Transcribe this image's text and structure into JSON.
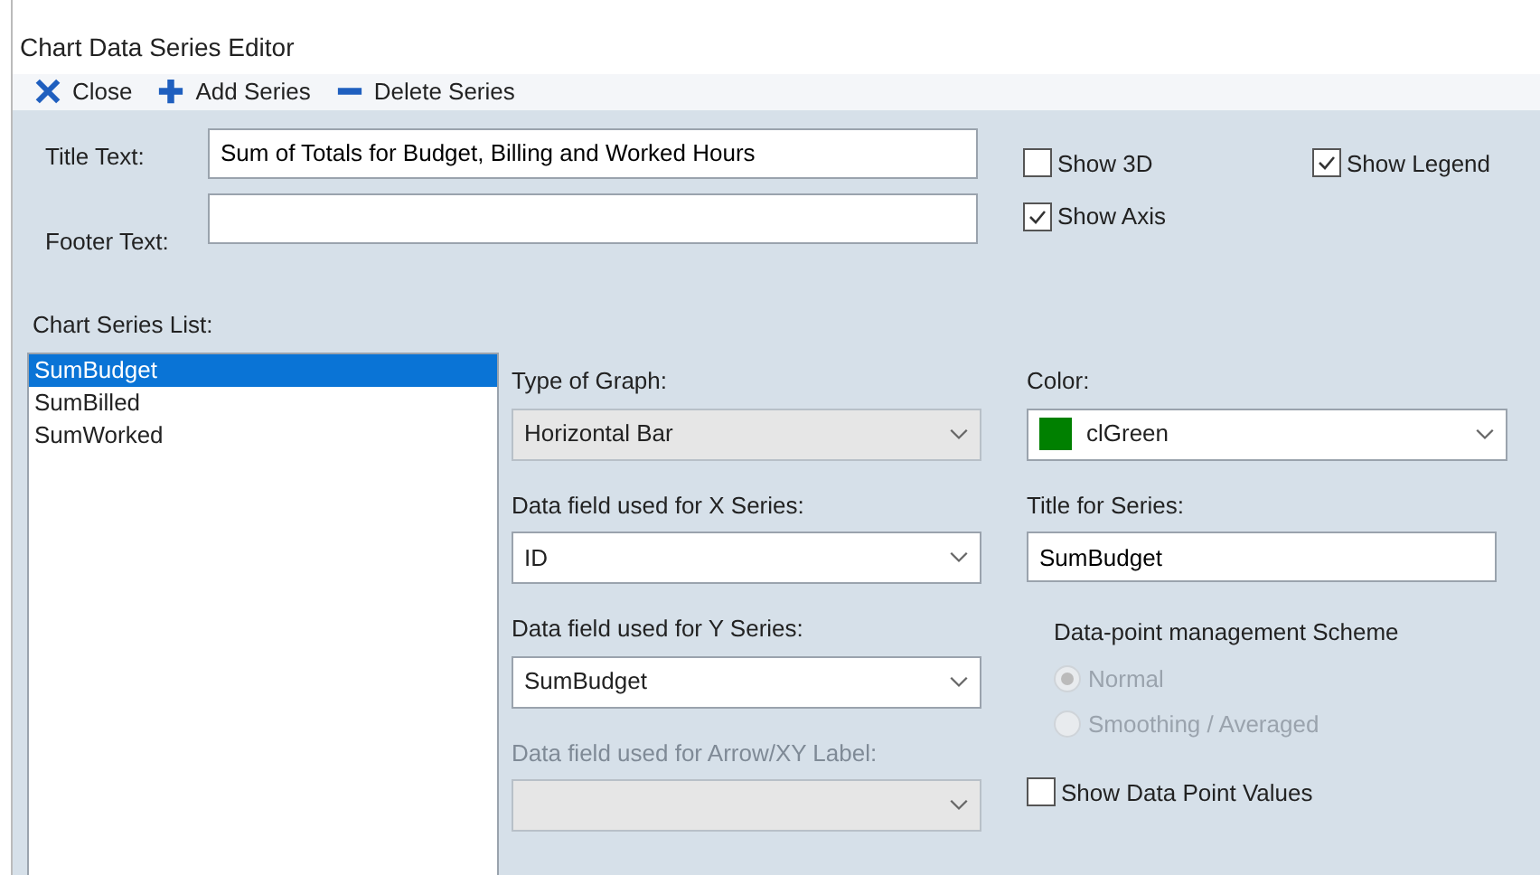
{
  "window": {
    "title": "Chart Data Series Editor"
  },
  "toolbar": [
    {
      "kind": "close",
      "label": "Close"
    },
    {
      "kind": "add",
      "label": "Add Series"
    },
    {
      "kind": "delete",
      "label": "Delete Series"
    }
  ],
  "title_text": {
    "label": "Title Text:",
    "value": "Sum of Totals for Budget, Billing and Worked Hours"
  },
  "footer_text": {
    "label": "Footer Text:"
  },
  "options": [
    {
      "label": "Show 3D",
      "checked": false
    },
    {
      "label": "Show Legend",
      "checked": true
    },
    {
      "label": "Show Axis",
      "checked": true
    }
  ],
  "series_list": {
    "label": "Chart Series List:",
    "items": [
      {
        "label": "SumBudget",
        "selected": true
      },
      {
        "label": "SumBilled",
        "selected": false
      },
      {
        "label": "SumWorked",
        "selected": false
      }
    ]
  },
  "graph_fields": [
    {
      "label": "Type of Graph:",
      "value": "Horizontal Bar",
      "disabled": true
    },
    {
      "label": "Data field used for X Series:",
      "value": "ID",
      "disabled": false
    },
    {
      "label": "Data field used for Y Series:",
      "value": "SumBudget",
      "disabled": false
    },
    {
      "label": "Data field used for Arrow/XY Label:",
      "disabled": true
    }
  ],
  "color": {
    "label": "Color:",
    "value": "clGreen",
    "color": "#008000"
  },
  "series_title": {
    "label": "Title for Series:",
    "value": "SumBudget"
  },
  "scheme": {
    "label": "Data-point management Scheme",
    "disabled": true,
    "options": [
      {
        "label": "Normal",
        "selected": true
      },
      {
        "label": "Smoothing / Averaged",
        "selected": false
      }
    ]
  },
  "show_data_point_values": {
    "label": "Show Data Point Values",
    "checked": false
  }
}
